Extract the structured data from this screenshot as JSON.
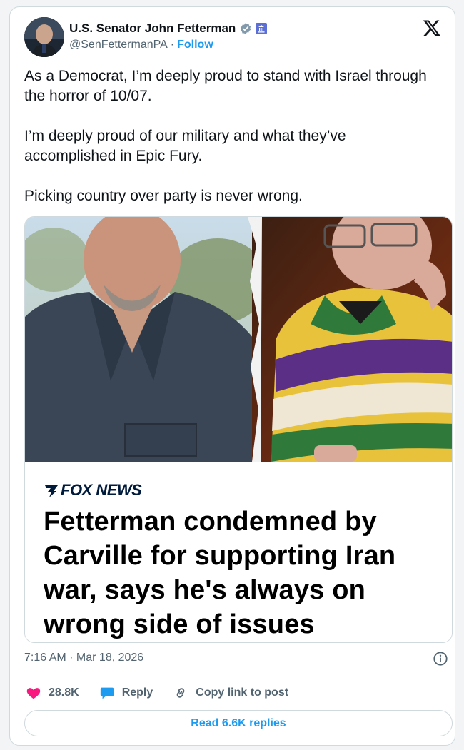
{
  "author": {
    "name": "U.S. Senator John Fetterman",
    "handle": "@SenFettermanPA",
    "separator": "·",
    "follow_label": "Follow"
  },
  "tweet": {
    "paragraphs": [
      "As a Democrat, I’m deeply proud to stand with Israel through the horror of 10/07.",
      "I’m deeply proud of our military and what they’ve accomplished in Epic Fury.",
      "Picking country over party is never wrong."
    ]
  },
  "card": {
    "source": "FOX NEWS",
    "headline": "Fetterman condemned by Carville for supporting Iran war, says he's always on wrong side of issues"
  },
  "footer": {
    "timestamp": "7:16 AM · Mar 18, 2026",
    "like_count": "28.8K",
    "reply_label": "Reply",
    "copy_link_label": "Copy link to post",
    "read_replies_label": "Read 6.6K replies"
  },
  "colors": {
    "accent": "#1d9bf0",
    "like": "#f91880",
    "muted": "#536471",
    "border": "#cfd9de"
  },
  "icons": [
    "verified-badge-icon",
    "government-badge-icon",
    "x-logo-icon",
    "info-icon",
    "heart-icon",
    "reply-bubble-icon",
    "link-icon"
  ]
}
